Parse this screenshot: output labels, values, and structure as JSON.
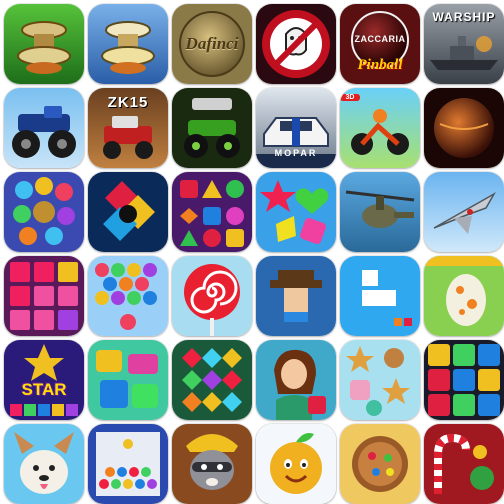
{
  "tiles": [
    {
      "id": "pinball-machine-green"
    },
    {
      "id": "pinball-machine-blue"
    },
    {
      "id": "dafinci",
      "text": "Dafinci"
    },
    {
      "id": "ghostbusters-pinball"
    },
    {
      "id": "zaccaria-pinball",
      "text": "Pinball",
      "top_text": "ZACCARIA"
    },
    {
      "id": "warship",
      "text": "WARSHIP"
    },
    {
      "id": "monster-truck-blue"
    },
    {
      "id": "zk15-truck",
      "text": "ZK15"
    },
    {
      "id": "monster-jam"
    },
    {
      "id": "mopar-racing",
      "text": "MOPAR"
    },
    {
      "id": "dirt-bike",
      "badge": "3D"
    },
    {
      "id": "planet-sphere"
    },
    {
      "id": "bubble-orbs"
    },
    {
      "id": "color-diamond"
    },
    {
      "id": "jewel-match"
    },
    {
      "id": "candy-shapes"
    },
    {
      "id": "attack-helicopter"
    },
    {
      "id": "fighter-jet"
    },
    {
      "id": "block-grid-pink"
    },
    {
      "id": "bubble-shooter"
    },
    {
      "id": "lollipop-swirl"
    },
    {
      "id": "pixel-hat"
    },
    {
      "id": "blue-blocks"
    },
    {
      "id": "dragon-egg"
    },
    {
      "id": "pop-star",
      "text": "STAR"
    },
    {
      "id": "jelly-blocks"
    },
    {
      "id": "gem-diamonds"
    },
    {
      "id": "princess-match"
    },
    {
      "id": "cookie-match"
    },
    {
      "id": "star-blocks"
    },
    {
      "id": "puppy-dog"
    },
    {
      "id": "column-blocks"
    },
    {
      "id": "raccoon-miner"
    },
    {
      "id": "fruit-character"
    },
    {
      "id": "cookie-candy"
    },
    {
      "id": "christmas-candy"
    }
  ]
}
